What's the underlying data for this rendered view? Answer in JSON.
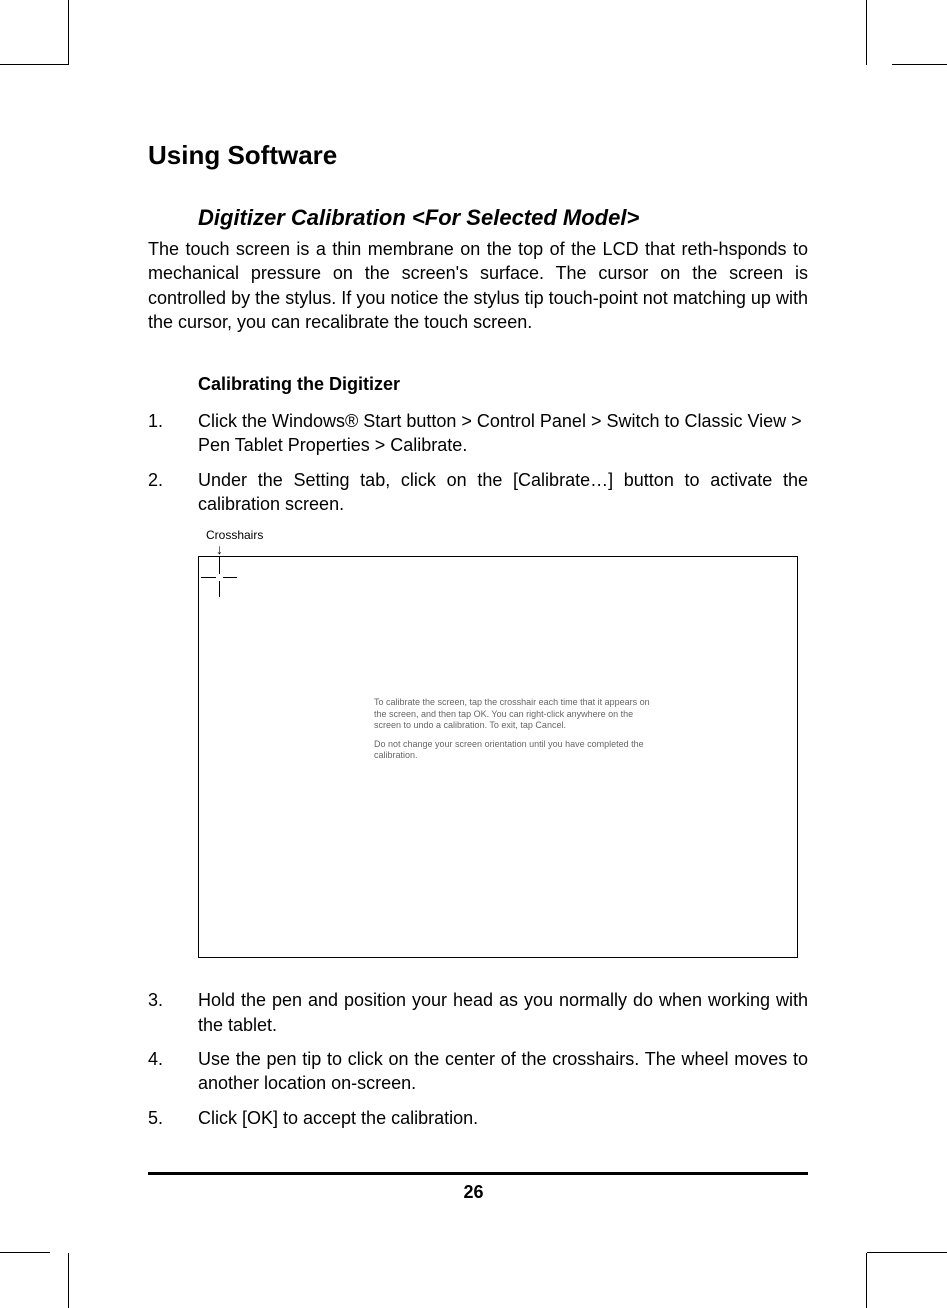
{
  "section_title": "Using Software",
  "subsection_title": "Digitizer Calibration <For Selected Model>",
  "intro_paragraph": "The touch screen is a thin membrane on the top of the LCD that reth-hsponds to mechanical pressure on the screen's surface. The cursor on the screen is controlled by the stylus. If you notice the stylus tip touch-point not matching up with the cursor, you can recalibrate the touch screen.",
  "step_heading": "Calibrating the Digitizer",
  "steps": {
    "s1_num": "1.",
    "s1_txt": "Click the Windows® Start button > Control Panel > Switch to Classic View > Pen Tablet Properties > Calibrate.",
    "s2_num": "2.",
    "s2_txt": "Under the Setting tab, click on the [Calibrate…] button to activate the calibration screen.",
    "s3_num": "3.",
    "s3_txt": "Hold the pen and position your head as you normally do when working with the tablet.",
    "s4_num": "4.",
    "s4_txt": "Use the pen tip to click on the center of the crosshairs. The wheel moves to another location on-screen.",
    "s5_num": "5.",
    "s5_txt": "Click [OK] to accept the calibration."
  },
  "figure": {
    "crosshairs_label": "Crosshairs",
    "arrow_glyph": "↓",
    "msg1": "To calibrate the screen, tap the crosshair each time that it appears on the screen, and then tap OK. You can right-click anywhere on the screen to undo a calibration. To exit, tap Cancel.",
    "msg2": "Do not change your screen orientation until you have completed the calibration."
  },
  "page_number": "26"
}
